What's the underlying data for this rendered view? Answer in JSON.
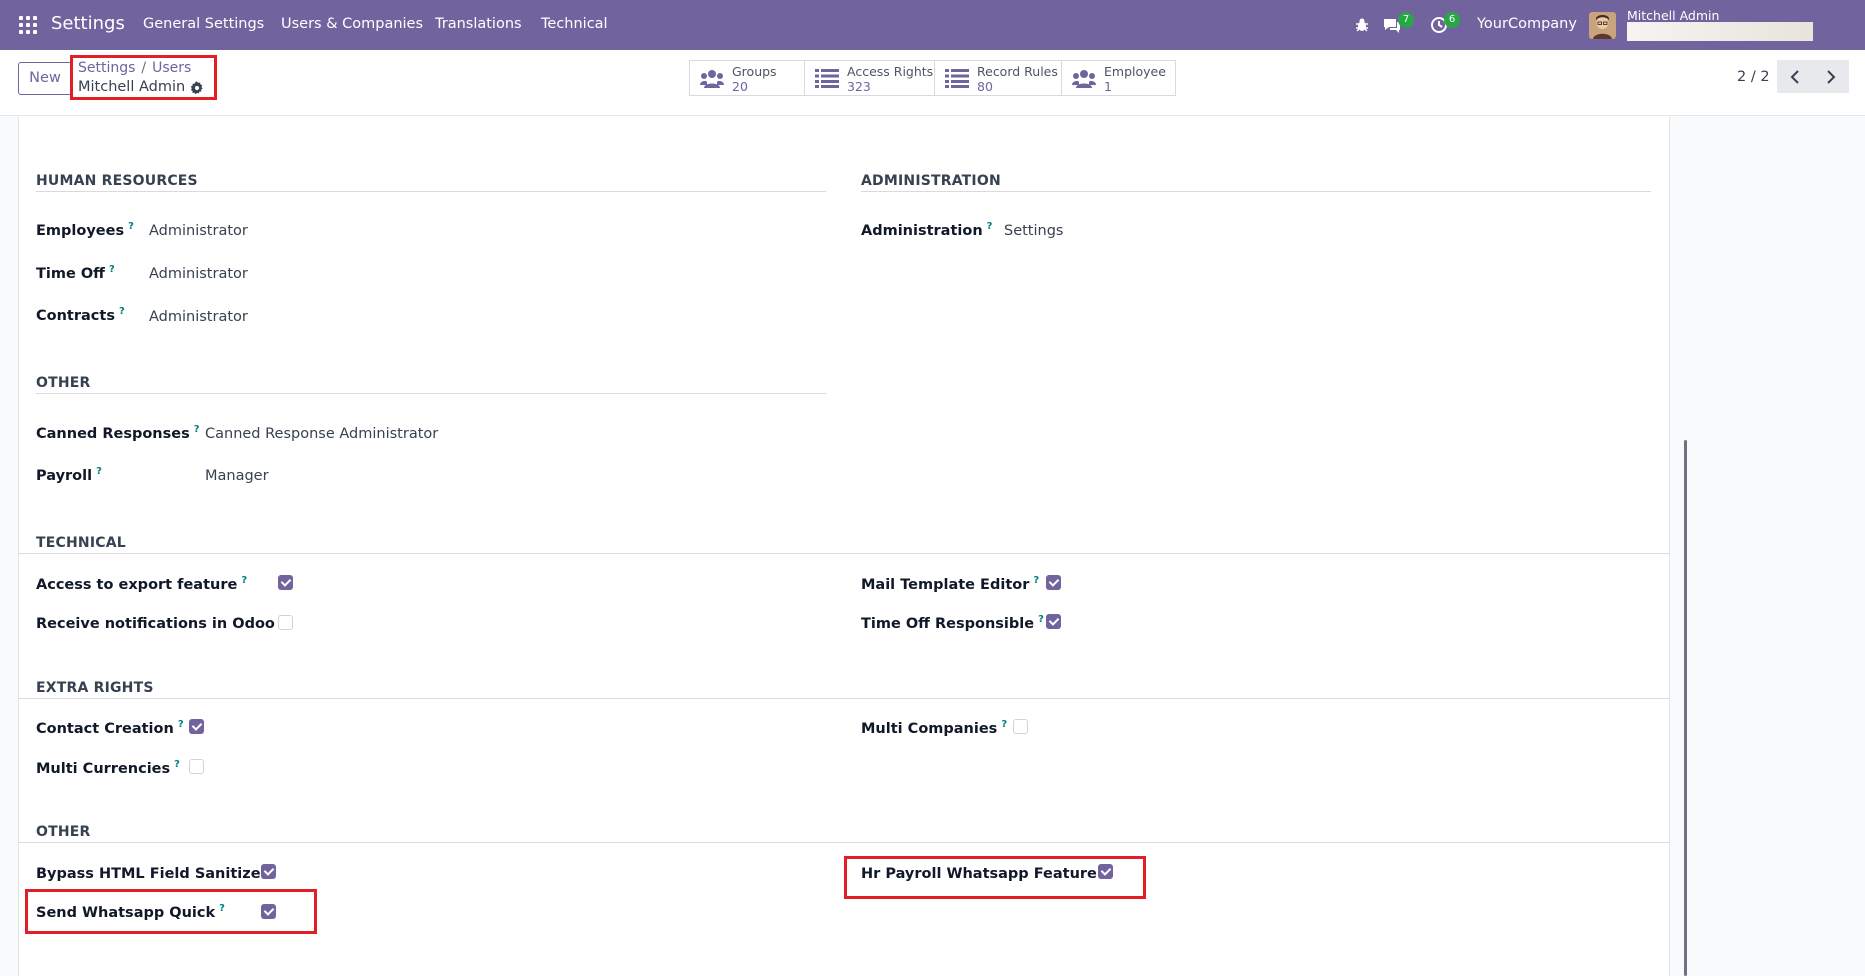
{
  "topbar": {
    "app_title": "Settings",
    "menu": [
      "General Settings",
      "Users & Companies",
      "Translations",
      "Technical"
    ],
    "icons": {
      "apps": "apps-grid-icon",
      "debug": "bug-icon",
      "messages": "chat-icon",
      "activities": "clock-icon"
    },
    "messages_count": "7",
    "activities_count": "6",
    "company": "YourCompany",
    "user_name": "Mitchell Admin"
  },
  "control": {
    "new_label": "New",
    "breadcrumb": [
      "Settings",
      "Users"
    ],
    "breadcrumb_sep": "/",
    "record_title": "Mitchell Admin",
    "stats": [
      {
        "label": "Groups",
        "value": "20",
        "icon": "users-icon"
      },
      {
        "label": "Access Rights",
        "value": "323",
        "icon": "list-icon"
      },
      {
        "label": "Record Rules",
        "value": "80",
        "icon": "list-icon"
      },
      {
        "label": "Employee",
        "value": "1",
        "icon": "users-icon"
      }
    ],
    "pager": "2 / 2",
    "prev_icon": "chevron-left-icon",
    "next_icon": "chevron-right-icon"
  },
  "form": {
    "hr": {
      "title": "HUMAN RESOURCES",
      "fields": [
        {
          "label": "Employees",
          "value": "Administrator"
        },
        {
          "label": "Time Off",
          "value": "Administrator"
        },
        {
          "label": "Contracts",
          "value": "Administrator"
        }
      ]
    },
    "admin": {
      "title": "ADMINISTRATION",
      "fields": [
        {
          "label": "Administration",
          "value": "Settings"
        }
      ]
    },
    "other1": {
      "title": "OTHER",
      "fields": [
        {
          "label": "Canned Responses",
          "value": "Canned Response Administrator"
        },
        {
          "label": "Payroll",
          "value": "Manager"
        }
      ]
    },
    "technical": {
      "title": "TECHNICAL",
      "left": [
        {
          "label": "Access to export feature",
          "checked": true
        },
        {
          "label": "Receive notifications in Odoo",
          "checked": false
        }
      ],
      "right": [
        {
          "label": "Mail Template Editor",
          "checked": true
        },
        {
          "label": "Time Off Responsible",
          "checked": true
        }
      ]
    },
    "extra": {
      "title": "EXTRA RIGHTS",
      "left": [
        {
          "label": "Contact Creation",
          "checked": true
        },
        {
          "label": "Multi Currencies",
          "checked": false
        }
      ],
      "right": [
        {
          "label": "Multi Companies",
          "checked": false
        }
      ]
    },
    "other2": {
      "title": "OTHER",
      "left": [
        {
          "label": "Bypass HTML Field Sanitize",
          "checked": true
        },
        {
          "label": "Send Whatsapp Quick",
          "checked": true
        }
      ],
      "right": [
        {
          "label": "Hr Payroll Whatsapp Feature",
          "checked": true
        }
      ]
    },
    "help_mark": "?"
  },
  "colors": {
    "brand": "#71639e",
    "highlight": "#e41e26",
    "help": "#017e84"
  }
}
